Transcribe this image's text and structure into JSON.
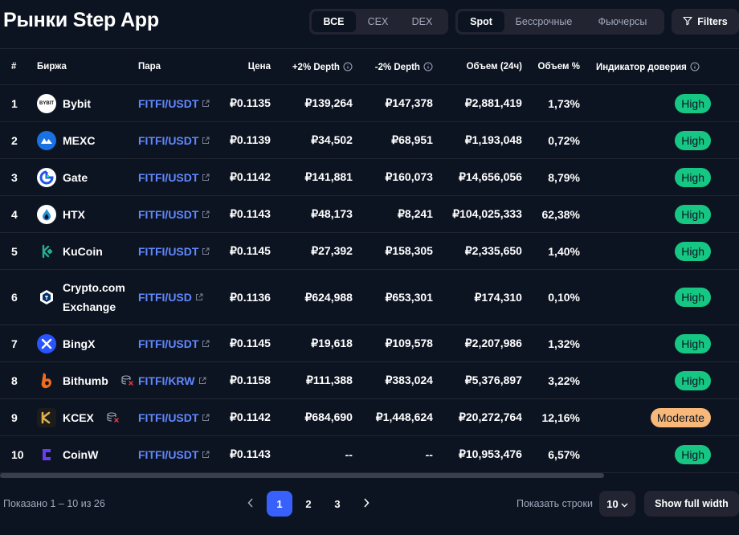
{
  "title": "Рынки Step App",
  "cex_filter": [
    "ВСЕ",
    "CEX",
    "DEX"
  ],
  "market_filter": [
    "Spot",
    "Бессрочные",
    "Фьючерсы"
  ],
  "filters_label": "Filters",
  "headers": {
    "num": "#",
    "exchange": "Биржа",
    "pair": "Пара",
    "price": "Цена",
    "plus_depth": "+2% Depth",
    "minus_depth": "-2% Depth",
    "volume": "Объем (24ч)",
    "volume_pct": "Объем %",
    "confidence": "Индикатор доверия"
  },
  "rows": [
    {
      "num": "1",
      "exchange": "Bybit",
      "logo": "bybit-logo",
      "pair": "FITFI/USDT",
      "price": "₽0.1135",
      "plus_depth": "₽139,264",
      "minus_depth": "₽147,378",
      "volume": "₽2,881,419",
      "volume_pct": "1,73%",
      "confidence": "High"
    },
    {
      "num": "2",
      "exchange": "MEXC",
      "logo": "mexc-logo",
      "pair": "FITFI/USDT",
      "price": "₽0.1139",
      "plus_depth": "₽34,502",
      "minus_depth": "₽68,951",
      "volume": "₽1,193,048",
      "volume_pct": "0,72%",
      "confidence": "High"
    },
    {
      "num": "3",
      "exchange": "Gate",
      "logo": "gate-logo",
      "pair": "FITFI/USDT",
      "price": "₽0.1142",
      "plus_depth": "₽141,881",
      "minus_depth": "₽160,073",
      "volume": "₽14,656,056",
      "volume_pct": "8,79%",
      "confidence": "High"
    },
    {
      "num": "4",
      "exchange": "HTX",
      "logo": "htx-logo",
      "pair": "FITFI/USDT",
      "price": "₽0.1143",
      "plus_depth": "₽48,173",
      "minus_depth": "₽8,241",
      "volume": "₽104,025,333",
      "volume_pct": "62,38%",
      "confidence": "High"
    },
    {
      "num": "5",
      "exchange": "KuCoin",
      "logo": "kucoin-logo",
      "pair": "FITFI/USDT",
      "price": "₽0.1145",
      "plus_depth": "₽27,392",
      "minus_depth": "₽158,305",
      "volume": "₽2,335,650",
      "volume_pct": "1,40%",
      "confidence": "High"
    },
    {
      "num": "6",
      "exchange_line1": "Crypto.com",
      "exchange_line2": "Exchange",
      "logo": "cryptocom-logo",
      "pair": "FITFI/USD",
      "price": "₽0.1136",
      "plus_depth": "₽624,988",
      "minus_depth": "₽653,301",
      "volume": "₽174,310",
      "volume_pct": "0,10%",
      "confidence": "High"
    },
    {
      "num": "7",
      "exchange": "BingX",
      "logo": "bingx-logo",
      "pair": "FITFI/USDT",
      "price": "₽0.1145",
      "plus_depth": "₽19,618",
      "minus_depth": "₽109,578",
      "volume": "₽2,207,986",
      "volume_pct": "1,32%",
      "confidence": "High"
    },
    {
      "num": "8",
      "exchange": "Bithumb",
      "logo": "bithumb-logo",
      "pair": "FITFI/KRW",
      "price": "₽0.1158",
      "plus_depth": "₽111,388",
      "minus_depth": "₽383,024",
      "volume": "₽5,376,897",
      "volume_pct": "3,22%",
      "confidence": "High"
    },
    {
      "num": "9",
      "exchange": "KCEX",
      "logo": "kcex-logo",
      "pair": "FITFI/USDT",
      "price": "₽0.1142",
      "plus_depth": "₽684,690",
      "minus_depth": "₽1,448,624",
      "volume": "₽20,272,764",
      "volume_pct": "12,16%",
      "confidence": "Moderate"
    },
    {
      "num": "10",
      "exchange": "CoinW",
      "logo": "coinw-logo",
      "pair": "FITFI/USDT",
      "price": "₽0.1143",
      "plus_depth": "--",
      "minus_depth": "--",
      "volume": "₽10,953,476",
      "volume_pct": "6,57%",
      "confidence": "High"
    }
  ],
  "footer": {
    "showing": "Показано 1 – 10 из 26",
    "pages": [
      "1",
      "2",
      "3"
    ],
    "rows_label": "Показать строки",
    "rows_value": "10",
    "full_width": "Show full width"
  },
  "colors": {
    "high_bg": "#16c784",
    "high_text": "#0d1421",
    "moderate_bg": "#f7b879",
    "moderate_text": "#0d1421",
    "link": "#6188ff",
    "accent": "#3861fb"
  }
}
